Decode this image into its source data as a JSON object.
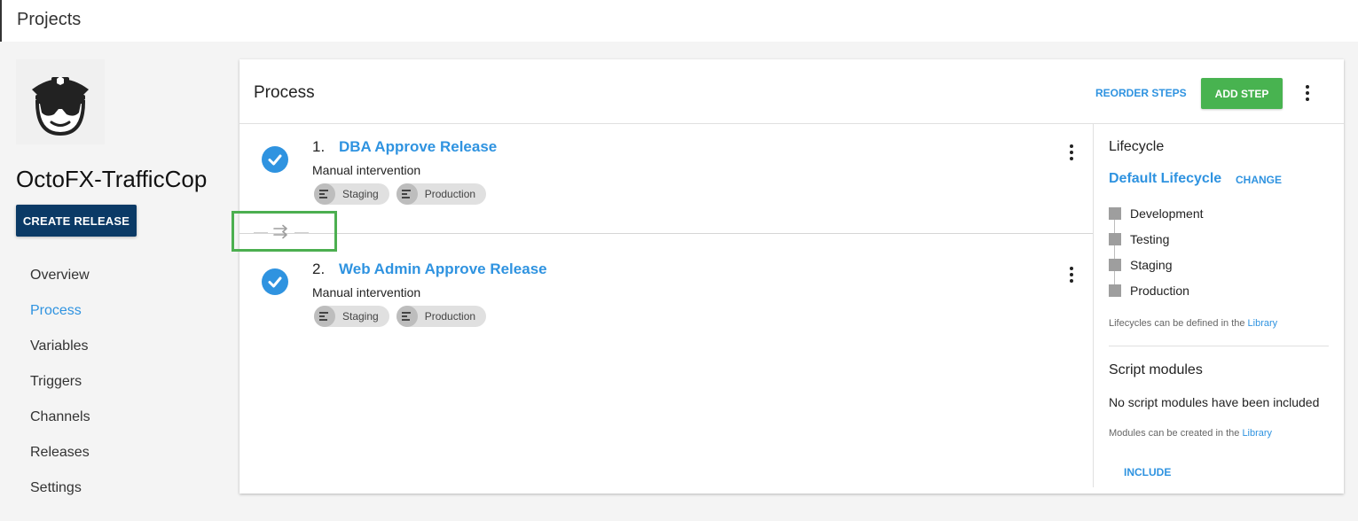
{
  "topbar": {
    "title": "Projects"
  },
  "sidebar": {
    "project_name": "OctoFX-TrafficCop",
    "create_release_label": "CREATE RELEASE",
    "nav": [
      {
        "label": "Overview",
        "active": false
      },
      {
        "label": "Process",
        "active": true
      },
      {
        "label": "Variables",
        "active": false
      },
      {
        "label": "Triggers",
        "active": false
      },
      {
        "label": "Channels",
        "active": false
      },
      {
        "label": "Releases",
        "active": false
      },
      {
        "label": "Settings",
        "active": false
      }
    ]
  },
  "process": {
    "title": "Process",
    "reorder_label": "REORDER STEPS",
    "add_step_label": "ADD STEP",
    "steps": [
      {
        "number": "1.",
        "name": "DBA Approve Release",
        "type": "Manual intervention",
        "environments": [
          "Staging",
          "Production"
        ]
      },
      {
        "number": "2.",
        "name": "Web Admin Approve Release",
        "type": "Manual intervention",
        "environments": [
          "Staging",
          "Production"
        ]
      }
    ]
  },
  "lifecycle": {
    "heading": "Lifecycle",
    "name": "Default Lifecycle",
    "change_label": "CHANGE",
    "phases": [
      "Development",
      "Testing",
      "Staging",
      "Production"
    ],
    "note_text": "Lifecycles can be defined in the ",
    "note_link": "Library"
  },
  "script_modules": {
    "heading": "Script modules",
    "empty_text": "No script modules have been included",
    "note_text": "Modules can be created in the ",
    "note_link": "Library",
    "include_label": "INCLUDE"
  },
  "colors": {
    "accent": "#2f93e0",
    "primary_button": "#0b3a66",
    "add_button": "#48b350",
    "highlight_box": "#4caf50"
  },
  "icons": {
    "avatar": "traffic-cop-avatar-icon",
    "step_status": "check-circle-icon",
    "environment": "environment-icon",
    "swap": "swap-arrows-icon",
    "menu": "more-vertical-icon"
  }
}
